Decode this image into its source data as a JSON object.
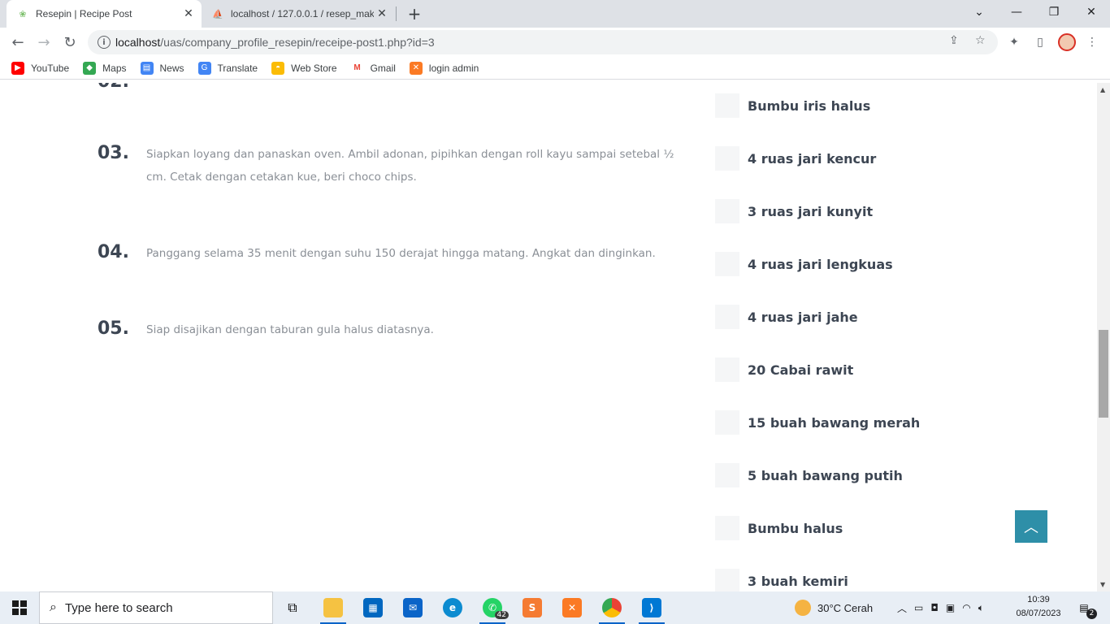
{
  "browser": {
    "tabs": [
      {
        "title": "Resepin | Recipe Post",
        "active": true
      },
      {
        "title": "localhost / 127.0.0.1 / resep_mak",
        "active": false
      }
    ],
    "url_host": "localhost",
    "url_path": "/uas/company_profile_resepin/receipe-post1.php?id=3",
    "bookmarks": [
      {
        "label": "YouTube",
        "icon": "youtube-icon",
        "color": "#ff0000"
      },
      {
        "label": "Maps",
        "icon": "maps-icon",
        "color": "#34a853"
      },
      {
        "label": "News",
        "icon": "news-icon",
        "color": "#4285f4"
      },
      {
        "label": "Translate",
        "icon": "translate-icon",
        "color": "#4285f4"
      },
      {
        "label": "Web Store",
        "icon": "webstore-icon",
        "color": "#fbbc05"
      },
      {
        "label": "Gmail",
        "icon": "gmail-icon",
        "color": "#ea4335"
      },
      {
        "label": "login admin",
        "icon": "xampp-icon",
        "color": "#fb7a24"
      }
    ]
  },
  "steps": [
    {
      "num": "03.",
      "text": "Siapkan loyang dan panaskan oven. Ambil adonan, pipihkan dengan roll kayu sampai setebal ½ cm. Cetak dengan cetakan kue, beri choco chips."
    },
    {
      "num": "04.",
      "text": "Panggang selama 35 menit dengan suhu 150 derajat hingga matang. Angkat dan dinginkan."
    },
    {
      "num": "05.",
      "text": "Siap disajikan dengan taburan gula halus diatasnya."
    }
  ],
  "ingredients": [
    "Bumbu iris halus",
    "4 ruas jari kencur",
    "3 ruas jari kunyit",
    "4 ruas jari lengkuas",
    "4 ruas jari jahe",
    "20 Cabai rawit",
    "15 buah bawang merah",
    "5 buah bawang putih",
    "Bumbu halus",
    "3 buah kemiri"
  ],
  "taskbar": {
    "search_placeholder": "Type here to search",
    "weather": "30°C  Cerah",
    "time": "10:39",
    "date": "08/07/2023",
    "whatsapp_badge": "42",
    "notif_count": "2"
  },
  "colors": {
    "accent": "#2e8fa8",
    "heading": "#3d4653",
    "muted": "#8a8f96"
  }
}
